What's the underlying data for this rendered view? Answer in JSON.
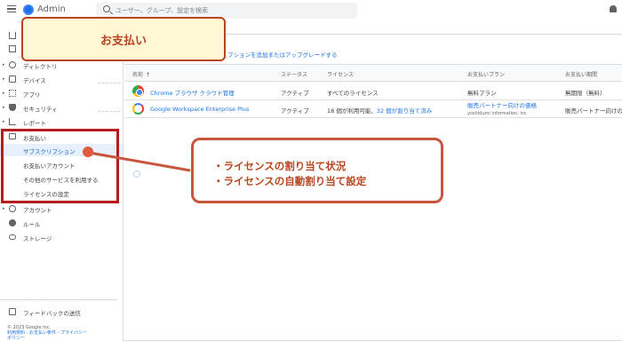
{
  "app": {
    "title": "Admin"
  },
  "search": {
    "placeholder": "ユーザー、グループ、設定を検索"
  },
  "sidebar": {
    "items": [
      {
        "label": "",
        "icon": "home-icon"
      },
      {
        "label": "",
        "icon": "dashboard-icon"
      },
      {
        "label": "ディレクトリ",
        "icon": "user-icon"
      },
      {
        "label": "デバイス",
        "icon": "device-icon"
      },
      {
        "label": "アプリ",
        "icon": "apps-icon"
      },
      {
        "label": "セキュリティ",
        "icon": "shield-icon"
      },
      {
        "label": "レポート",
        "icon": "bar-chart-icon"
      },
      {
        "label": "お支払い",
        "icon": "credit-card-icon"
      }
    ],
    "billing_sub": [
      {
        "label": "サブスクリプション",
        "active": true
      },
      {
        "label": "お支払いアカウント"
      },
      {
        "label": "その他のサービスを利用する"
      },
      {
        "label": "ライセンスの設定"
      }
    ],
    "items_after": [
      {
        "label": "アカウント",
        "icon": "at-icon"
      },
      {
        "label": "ルール",
        "icon": "rule-icon"
      },
      {
        "label": "ストレージ",
        "icon": "cloud-icon"
      }
    ],
    "feedback": "フィードバックの送信",
    "footer": {
      "copyright": "© 2023 Google Inc.",
      "terms": "利用規約",
      "billing_terms": "お支払い条件",
      "privacy": "プライバシー",
      "policy": "ポリシー"
    }
  },
  "main": {
    "add_link": "プションを追加またはアップグレードする",
    "columns": [
      "名前",
      "ステータス",
      "ライセンス",
      "お支払いプラン",
      "お支払い期間"
    ],
    "rows": [
      {
        "icon": "chrome-icon",
        "name": "Chrome ブラウザ クラウド管理",
        "status": "アクティブ",
        "license": "すべてのライセンス",
        "plan": "無料プラン",
        "plan_sub": "",
        "period": "無期限（無料）"
      },
      {
        "icon": "google-icon",
        "name": "Google Workspace Enterprise Plus",
        "status": "アクティブ",
        "license_prefix": "18 個が利用可能、",
        "license_link": "32 個が割り当て済み",
        "plan": "販売パートナー向けの価格",
        "plan_sub": "yoshidumi information, inc",
        "period": "販売パートナー向けの"
      }
    ]
  },
  "annotations": {
    "title": "お支払い",
    "note_lines": [
      "・ライセンスの割り当て状況",
      "・ライセンスの自動割り当て設定"
    ]
  },
  "colors": {
    "accent": "#1a73e8",
    "annotation": "#b9451e",
    "highlight": "#b71c1c"
  }
}
